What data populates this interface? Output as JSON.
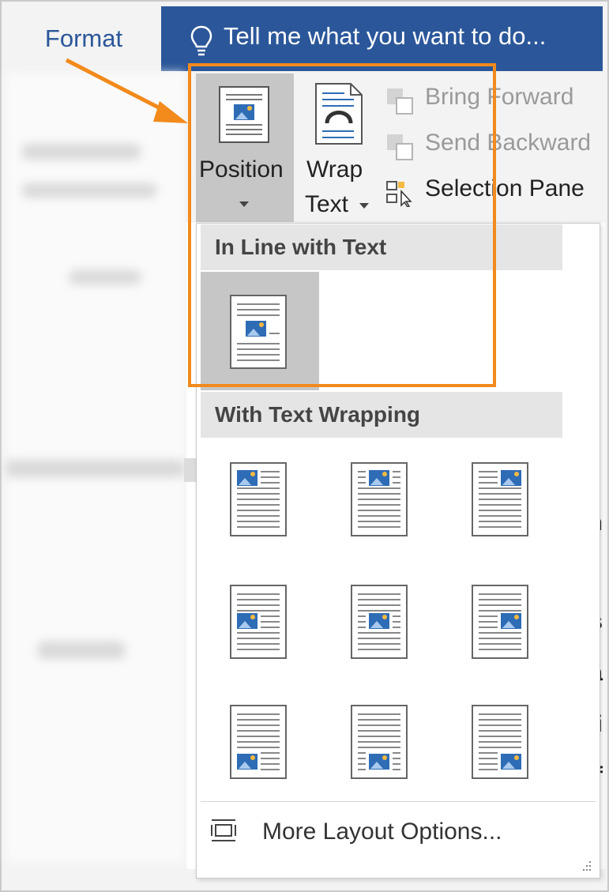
{
  "ribbon": {
    "active_tab": "Format",
    "tell_me": "Tell me what you want to do...",
    "position_label": "Position",
    "wrap_label_line1": "Wrap",
    "wrap_label_line2": "Text",
    "bring_forward": "Bring Forward",
    "send_backward": "Send Backward",
    "selection_pane": "Selection Pane"
  },
  "position_menu": {
    "inline_heading": "In Line with Text",
    "wrapping_heading": "With Text Wrapping",
    "more_options": "More Layout Options...",
    "wrapping_grid": [
      [
        "top-left",
        "top-center",
        "top-right"
      ],
      [
        "middle-left",
        "middle-center",
        "middle-right"
      ],
      [
        "bottom-left",
        "bottom-center",
        "bottom-right"
      ]
    ]
  },
  "colors": {
    "ribbon_blue": "#2b579a",
    "highlight_orange": "#f28a1c",
    "selected_gray": "#c6c6c6"
  }
}
